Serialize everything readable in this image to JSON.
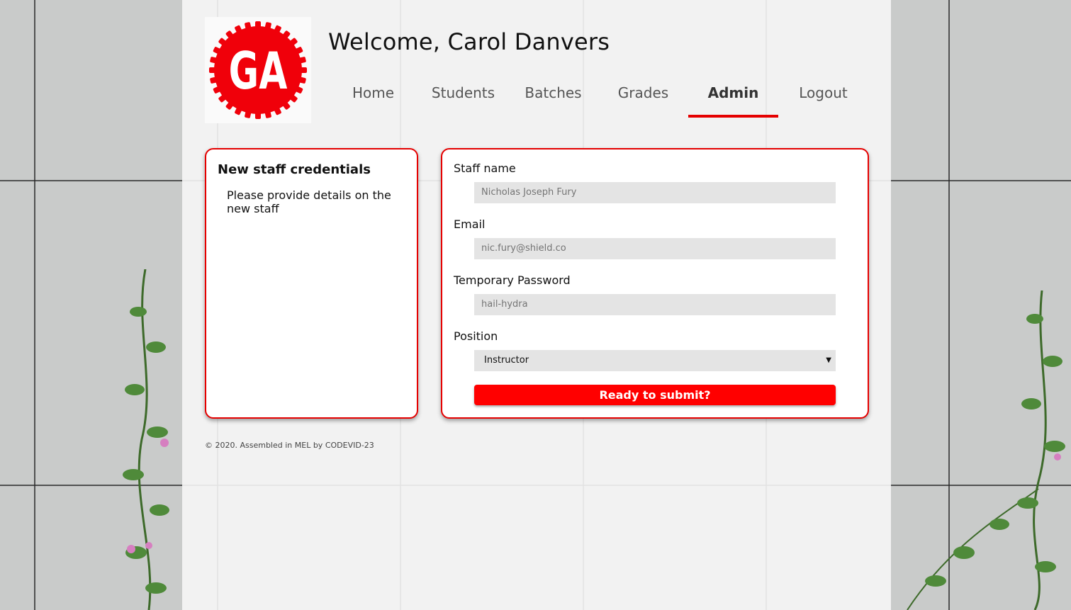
{
  "header": {
    "logo_text": "GA",
    "welcome": "Welcome, Carol Danvers"
  },
  "nav": {
    "items": [
      {
        "label": "Home"
      },
      {
        "label": "Students"
      },
      {
        "label": "Batches"
      },
      {
        "label": "Grades"
      },
      {
        "label": "Admin",
        "active": true
      },
      {
        "label": "Logout"
      }
    ]
  },
  "info_card": {
    "title": "New staff credentials",
    "description": "Please provide details on the new staff"
  },
  "form": {
    "staff_name": {
      "label": "Staff name",
      "placeholder": "Nicholas Joseph Fury"
    },
    "email": {
      "label": "Email",
      "placeholder": "nic.fury@shield.co"
    },
    "password": {
      "label": "Temporary Password",
      "placeholder": "hail-hydra"
    },
    "position": {
      "label": "Position",
      "selected": "Instructor"
    },
    "submit_label": "Ready to submit?"
  },
  "footer": {
    "text": "© 2020. Assembled in MEL by CODEVID-23"
  },
  "colors": {
    "accent": "#e50000",
    "button": "#ff0000",
    "logo": "#f0000a"
  },
  "icons": {
    "select_arrow": "chevron-down-icon"
  }
}
